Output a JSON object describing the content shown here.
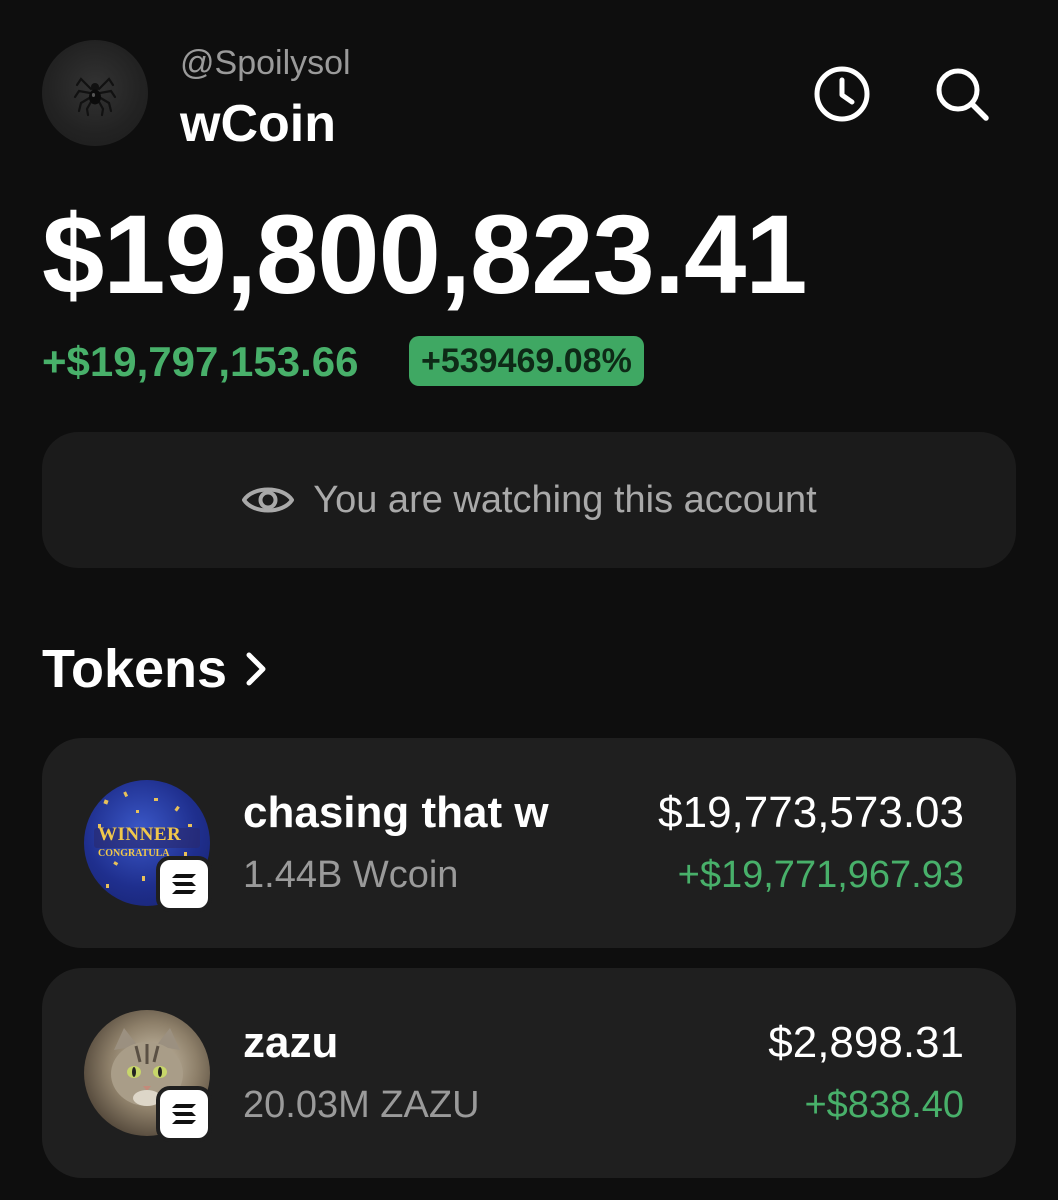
{
  "header": {
    "handle": "@Spoilysol",
    "account_name": "wCoin",
    "avatar_icon": "spider-icon",
    "history_icon": "clock-icon",
    "search_icon": "search-icon"
  },
  "balance": {
    "total": "$19,800,823.41",
    "change_amount": "+$19,797,153.66",
    "change_percent": "+539469.08%"
  },
  "watch_banner": {
    "icon": "eye-icon",
    "text": "You are watching this account"
  },
  "tokens": {
    "title": "Tokens",
    "chevron_icon": "chevron-right-icon",
    "items": [
      {
        "name": "chasing that w",
        "amount": "1.44B Wcoin",
        "value": "$19,773,573.03",
        "change": "+$19,771,967.93",
        "logo_text_1": "WINNER",
        "logo_text_2": "CONGRATULA",
        "chain_icon": "solana-icon"
      },
      {
        "name": "zazu",
        "amount": "20.03M ZAZU",
        "value": "$2,898.31",
        "change": "+$838.40",
        "chain_icon": "solana-icon"
      }
    ]
  },
  "colors": {
    "background": "#0e0e0e",
    "card": "#1f1f1f",
    "positive": "#48b06a",
    "badge": "#3fa863",
    "muted_text": "#9a9a9a"
  }
}
